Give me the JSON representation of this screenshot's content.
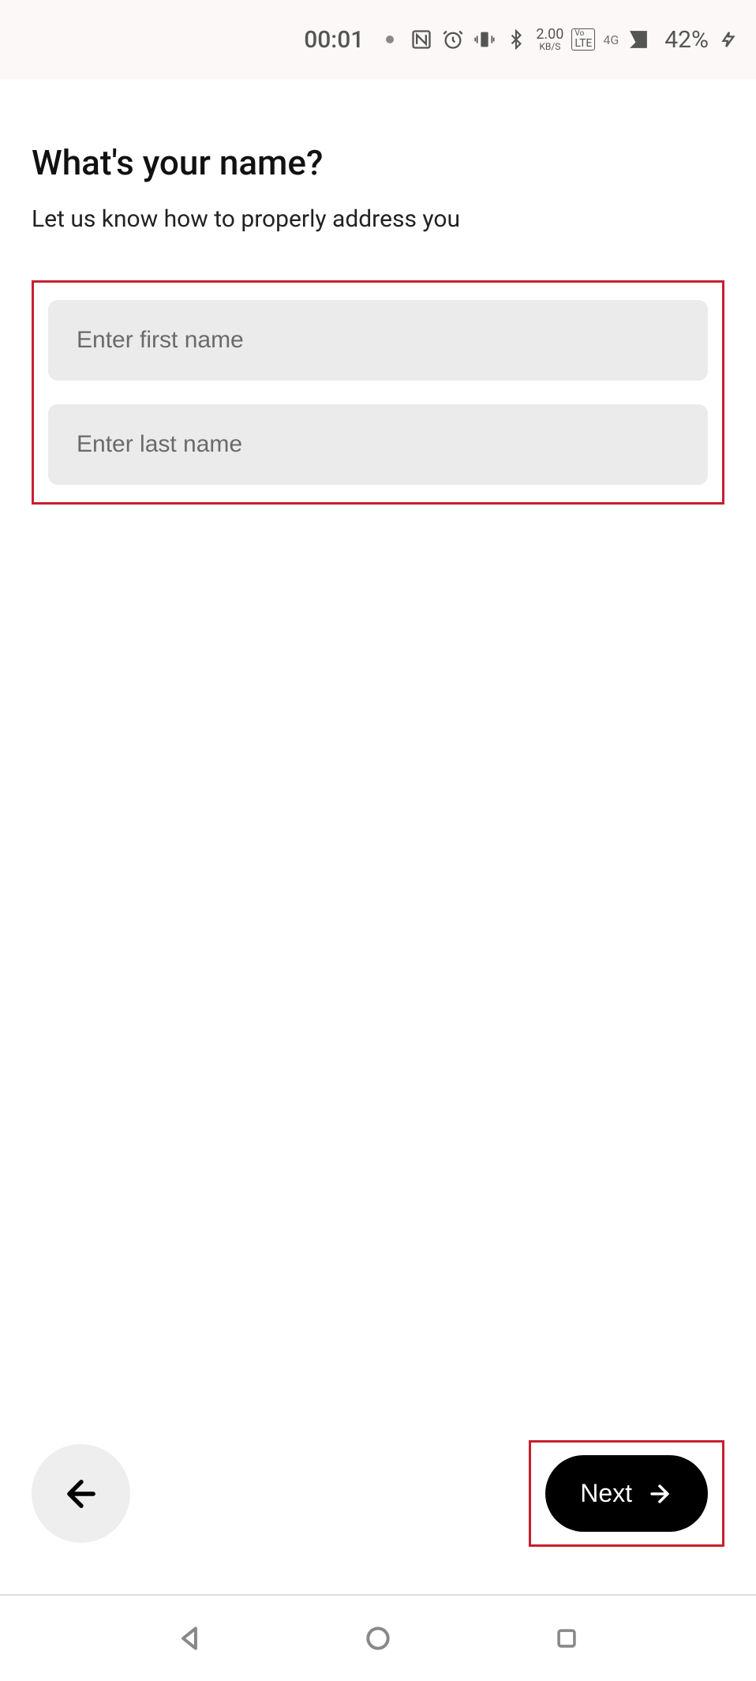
{
  "statusBar": {
    "time": "00:01",
    "networkSpeed": "2.00",
    "networkUnit": "KB/S",
    "lteLabel": "LTE",
    "voLabel": "Vo",
    "signal": "4G",
    "battery": "42%"
  },
  "page": {
    "title": "What's your name?",
    "subtitle": "Let us know how to properly address you"
  },
  "form": {
    "firstNamePlaceholder": "Enter first name",
    "firstNameValue": "",
    "lastNamePlaceholder": "Enter last name",
    "lastNameValue": ""
  },
  "nav": {
    "nextLabel": "Next"
  }
}
